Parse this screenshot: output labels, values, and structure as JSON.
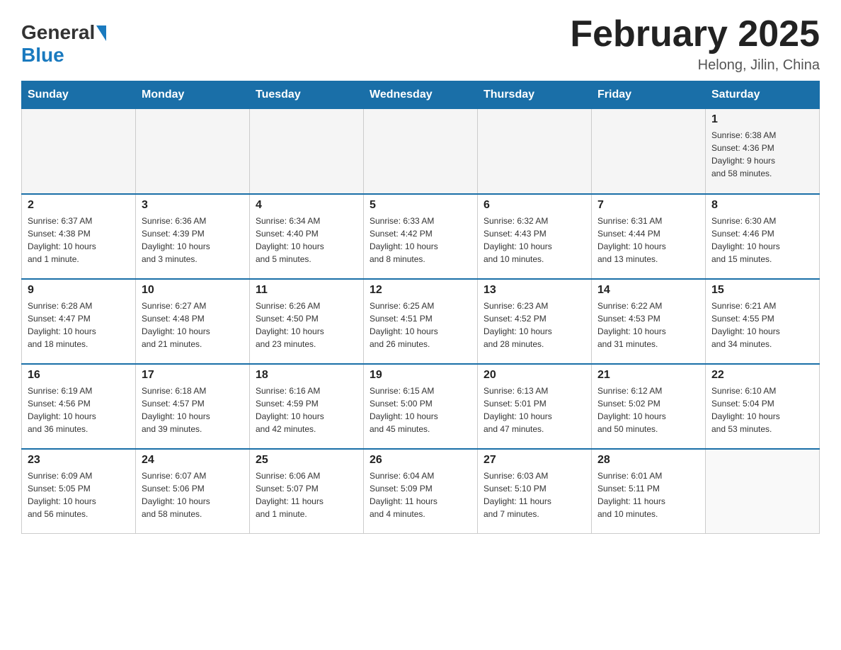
{
  "header": {
    "logo": {
      "general": "General",
      "blue": "Blue",
      "alt": "GeneralBlue Logo"
    },
    "title": "February 2025",
    "location": "Helong, Jilin, China"
  },
  "weekdays": [
    "Sunday",
    "Monday",
    "Tuesday",
    "Wednesday",
    "Thursday",
    "Friday",
    "Saturday"
  ],
  "weeks": [
    [
      {
        "day": "",
        "info": ""
      },
      {
        "day": "",
        "info": ""
      },
      {
        "day": "",
        "info": ""
      },
      {
        "day": "",
        "info": ""
      },
      {
        "day": "",
        "info": ""
      },
      {
        "day": "",
        "info": ""
      },
      {
        "day": "1",
        "info": "Sunrise: 6:38 AM\nSunset: 4:36 PM\nDaylight: 9 hours\nand 58 minutes."
      }
    ],
    [
      {
        "day": "2",
        "info": "Sunrise: 6:37 AM\nSunset: 4:38 PM\nDaylight: 10 hours\nand 1 minute."
      },
      {
        "day": "3",
        "info": "Sunrise: 6:36 AM\nSunset: 4:39 PM\nDaylight: 10 hours\nand 3 minutes."
      },
      {
        "day": "4",
        "info": "Sunrise: 6:34 AM\nSunset: 4:40 PM\nDaylight: 10 hours\nand 5 minutes."
      },
      {
        "day": "5",
        "info": "Sunrise: 6:33 AM\nSunset: 4:42 PM\nDaylight: 10 hours\nand 8 minutes."
      },
      {
        "day": "6",
        "info": "Sunrise: 6:32 AM\nSunset: 4:43 PM\nDaylight: 10 hours\nand 10 minutes."
      },
      {
        "day": "7",
        "info": "Sunrise: 6:31 AM\nSunset: 4:44 PM\nDaylight: 10 hours\nand 13 minutes."
      },
      {
        "day": "8",
        "info": "Sunrise: 6:30 AM\nSunset: 4:46 PM\nDaylight: 10 hours\nand 15 minutes."
      }
    ],
    [
      {
        "day": "9",
        "info": "Sunrise: 6:28 AM\nSunset: 4:47 PM\nDaylight: 10 hours\nand 18 minutes."
      },
      {
        "day": "10",
        "info": "Sunrise: 6:27 AM\nSunset: 4:48 PM\nDaylight: 10 hours\nand 21 minutes."
      },
      {
        "day": "11",
        "info": "Sunrise: 6:26 AM\nSunset: 4:50 PM\nDaylight: 10 hours\nand 23 minutes."
      },
      {
        "day": "12",
        "info": "Sunrise: 6:25 AM\nSunset: 4:51 PM\nDaylight: 10 hours\nand 26 minutes."
      },
      {
        "day": "13",
        "info": "Sunrise: 6:23 AM\nSunset: 4:52 PM\nDaylight: 10 hours\nand 28 minutes."
      },
      {
        "day": "14",
        "info": "Sunrise: 6:22 AM\nSunset: 4:53 PM\nDaylight: 10 hours\nand 31 minutes."
      },
      {
        "day": "15",
        "info": "Sunrise: 6:21 AM\nSunset: 4:55 PM\nDaylight: 10 hours\nand 34 minutes."
      }
    ],
    [
      {
        "day": "16",
        "info": "Sunrise: 6:19 AM\nSunset: 4:56 PM\nDaylight: 10 hours\nand 36 minutes."
      },
      {
        "day": "17",
        "info": "Sunrise: 6:18 AM\nSunset: 4:57 PM\nDaylight: 10 hours\nand 39 minutes."
      },
      {
        "day": "18",
        "info": "Sunrise: 6:16 AM\nSunset: 4:59 PM\nDaylight: 10 hours\nand 42 minutes."
      },
      {
        "day": "19",
        "info": "Sunrise: 6:15 AM\nSunset: 5:00 PM\nDaylight: 10 hours\nand 45 minutes."
      },
      {
        "day": "20",
        "info": "Sunrise: 6:13 AM\nSunset: 5:01 PM\nDaylight: 10 hours\nand 47 minutes."
      },
      {
        "day": "21",
        "info": "Sunrise: 6:12 AM\nSunset: 5:02 PM\nDaylight: 10 hours\nand 50 minutes."
      },
      {
        "day": "22",
        "info": "Sunrise: 6:10 AM\nSunset: 5:04 PM\nDaylight: 10 hours\nand 53 minutes."
      }
    ],
    [
      {
        "day": "23",
        "info": "Sunrise: 6:09 AM\nSunset: 5:05 PM\nDaylight: 10 hours\nand 56 minutes."
      },
      {
        "day": "24",
        "info": "Sunrise: 6:07 AM\nSunset: 5:06 PM\nDaylight: 10 hours\nand 58 minutes."
      },
      {
        "day": "25",
        "info": "Sunrise: 6:06 AM\nSunset: 5:07 PM\nDaylight: 11 hours\nand 1 minute."
      },
      {
        "day": "26",
        "info": "Sunrise: 6:04 AM\nSunset: 5:09 PM\nDaylight: 11 hours\nand 4 minutes."
      },
      {
        "day": "27",
        "info": "Sunrise: 6:03 AM\nSunset: 5:10 PM\nDaylight: 11 hours\nand 7 minutes."
      },
      {
        "day": "28",
        "info": "Sunrise: 6:01 AM\nSunset: 5:11 PM\nDaylight: 11 hours\nand 10 minutes."
      },
      {
        "day": "",
        "info": ""
      }
    ]
  ]
}
